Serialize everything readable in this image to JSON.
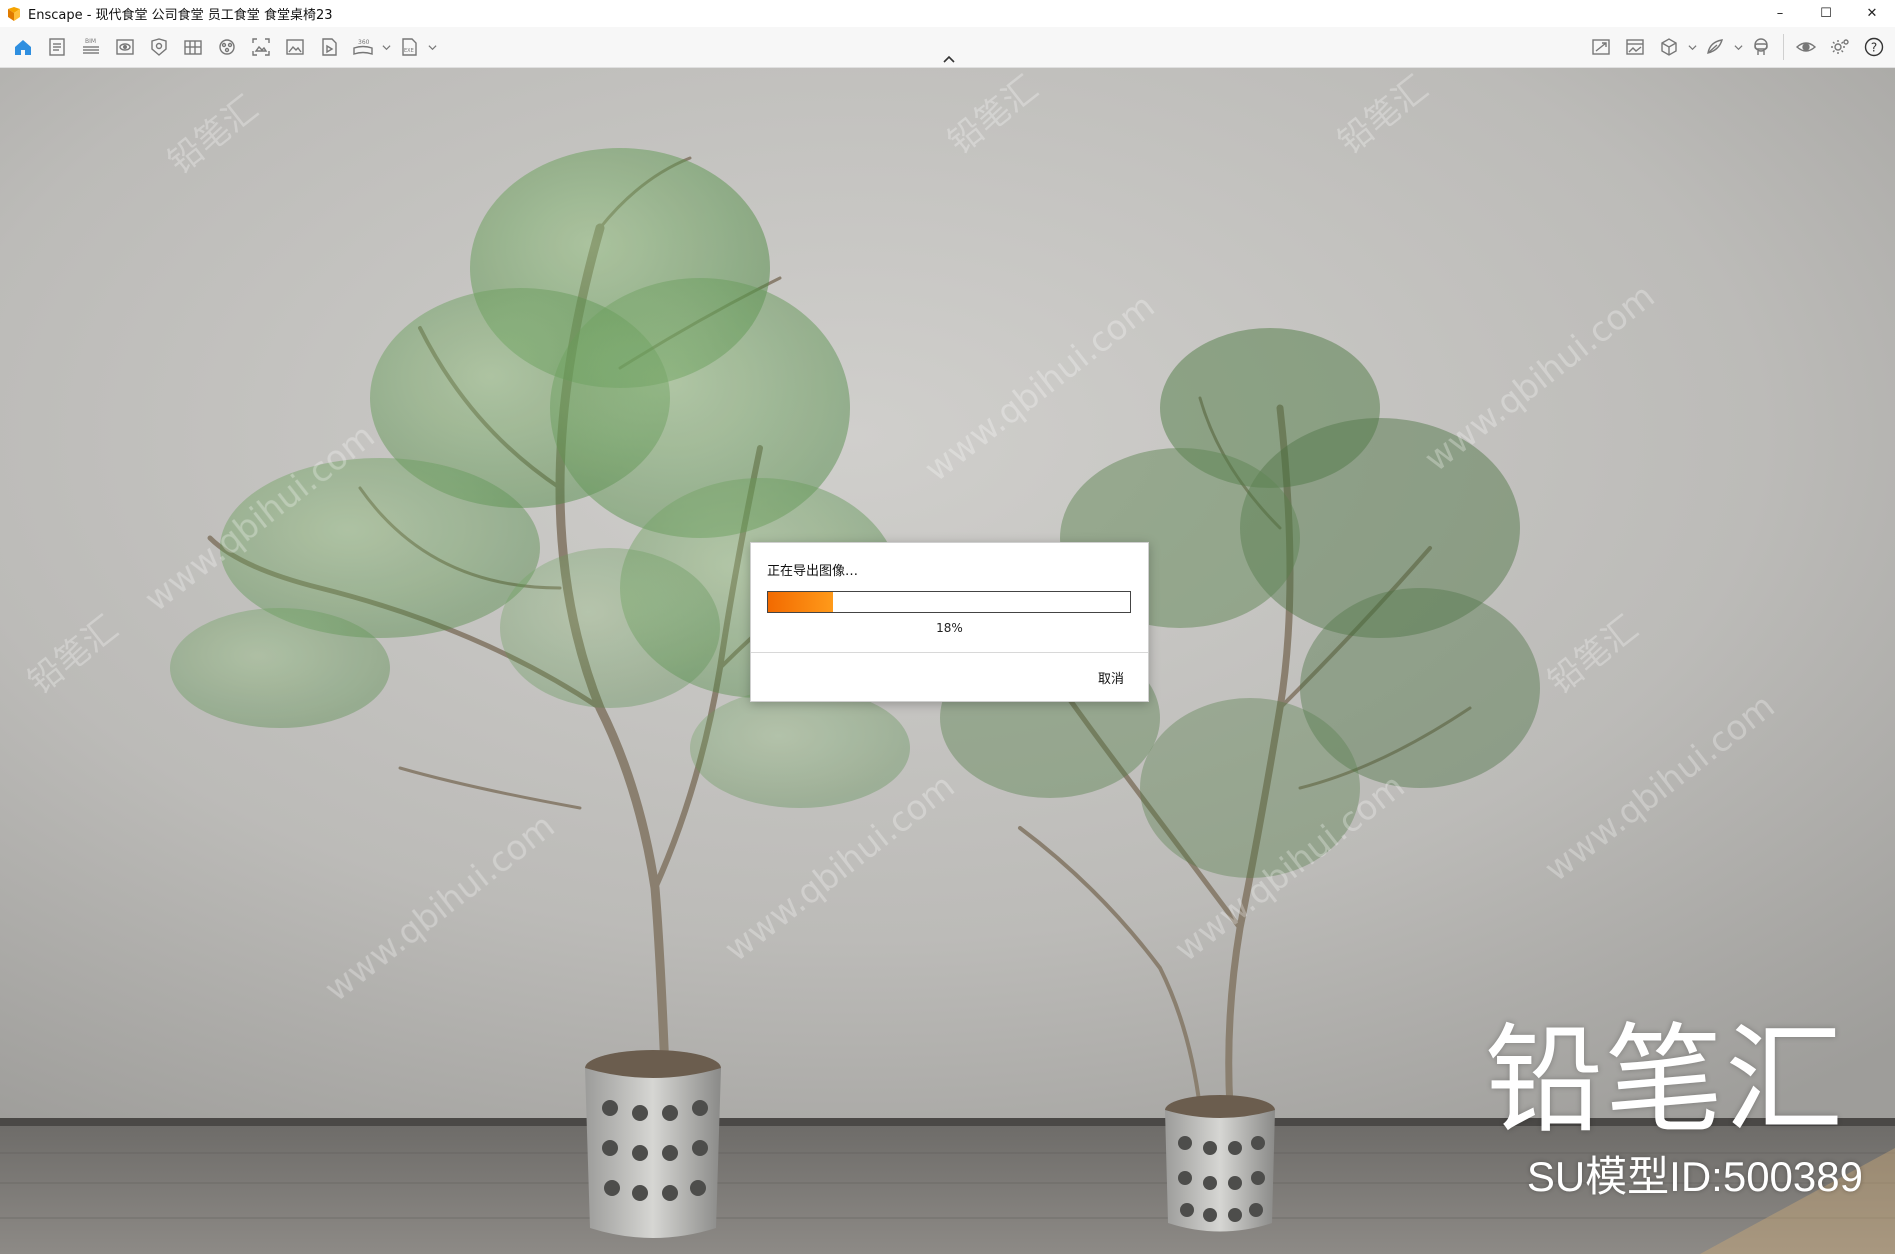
{
  "window": {
    "title": "Enscape - 现代食堂 公司食堂 员工食堂 食堂桌椅23",
    "controls": {
      "minimize": "–",
      "maximize": "☐",
      "close": "✕"
    }
  },
  "toolbar": {
    "left_icons": [
      "home-icon",
      "notes-icon",
      "bim-icon",
      "view-icon",
      "asset-library-icon",
      "material-editor-icon",
      "atmosphere-icon",
      "screenshot-icon",
      "image-export-icon",
      "video-export-icon",
      "panorama-360-icon",
      "exe-export-icon"
    ],
    "bim_label": "BIM",
    "pano_label": "360",
    "exe_label": "EXE",
    "right_icons": [
      "sync-views-icon",
      "batch-render-icon",
      "3d-view-icon",
      "sketch-mode-icon",
      "vr-headset-icon",
      "visibility-icon",
      "settings-icon",
      "help-icon"
    ],
    "help_glyph": "?"
  },
  "scene": {
    "watermark_text": "www.qbihui.com",
    "watermark_brand": "铅笔汇",
    "brand_logo": "铅笔汇",
    "model_id": "SU模型ID:500389"
  },
  "dialog": {
    "title": "正在导出图像…",
    "progress_percent": 18,
    "progress_label": "18%",
    "cancel_label": "取消",
    "accent_color": "#f26a00"
  }
}
